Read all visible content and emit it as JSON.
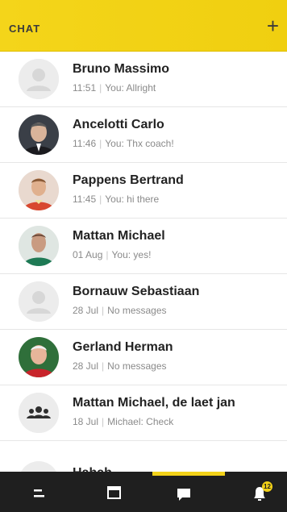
{
  "header": {
    "title": "CHAT",
    "add_label": "+",
    "accent": "#f3d21a"
  },
  "chats": [
    {
      "name": "Bruno Massimo",
      "time": "11:51",
      "preview": "You: Allright",
      "avatar": "placeholder-person"
    },
    {
      "name": "Ancelotti Carlo",
      "time": "11:46",
      "preview": "You: Thx coach!",
      "avatar": "photo"
    },
    {
      "name": "Pappens Bertrand",
      "time": "11:45",
      "preview": "You: hi there",
      "avatar": "photo"
    },
    {
      "name": "Mattan Michael",
      "time": "01 Aug",
      "preview": "You: yes!",
      "avatar": "photo"
    },
    {
      "name": "Bornauw Sebastiaan",
      "time": "28 Jul",
      "preview": "No messages",
      "avatar": "placeholder-person"
    },
    {
      "name": "Gerland Herman",
      "time": "28 Jul",
      "preview": "No messages",
      "avatar": "photo"
    },
    {
      "name": "Mattan Michael, de laet jan",
      "time": "18 Jul",
      "preview": "Michael: Check",
      "avatar": "group"
    }
  ],
  "partial_row": {
    "name": "Hahah"
  },
  "navbar": {
    "items": [
      "menu-icon",
      "calendar-icon",
      "chat-icon",
      "notifications-icon"
    ],
    "badge_count": "12",
    "background": "#1f1f1f"
  }
}
